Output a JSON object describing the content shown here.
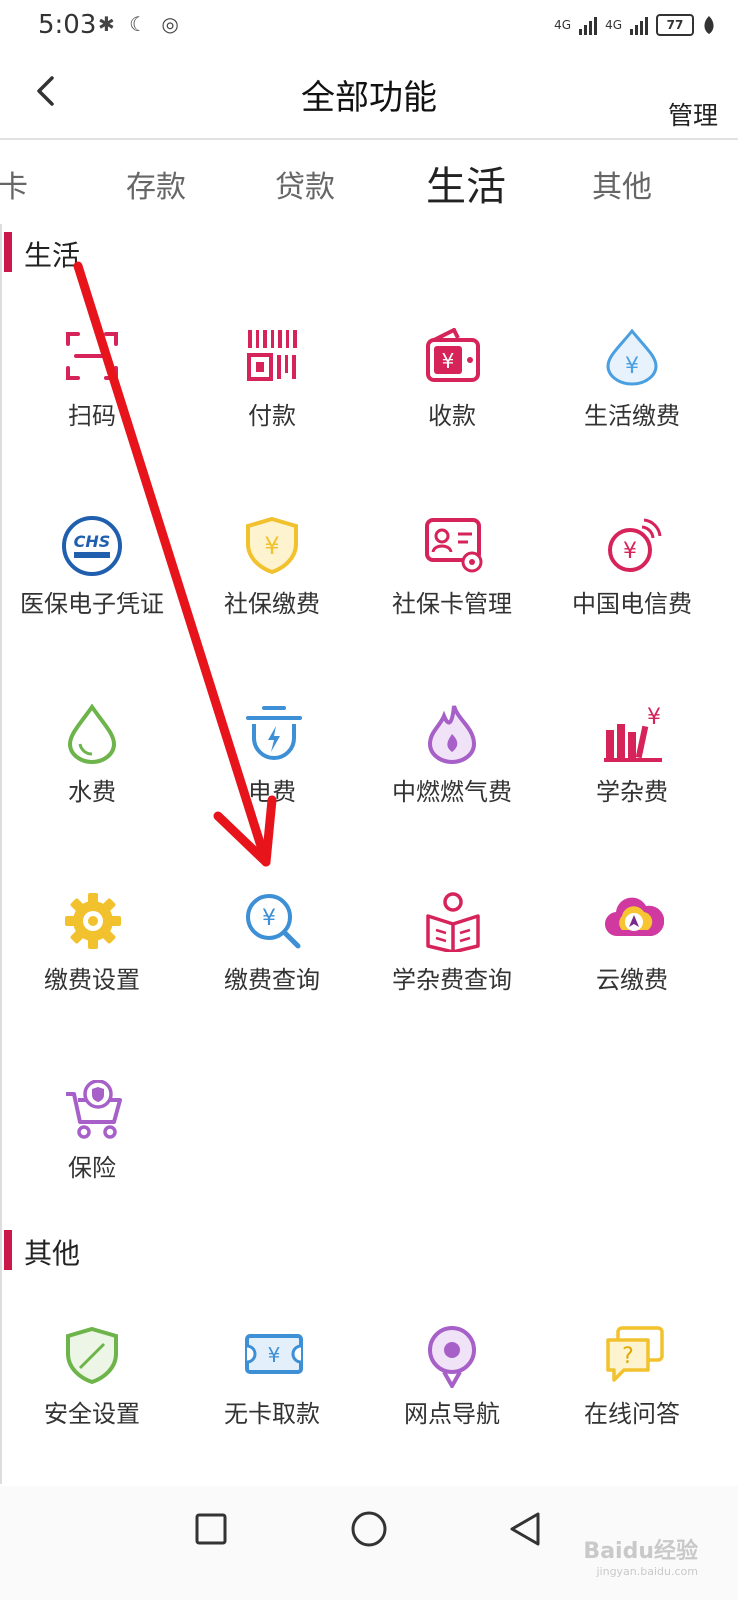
{
  "status_bar": {
    "time": "5:03",
    "icons": "✱ ☾ ◎",
    "signal1": "4G",
    "signal2": "4G",
    "battery": "77"
  },
  "header": {
    "title": "全部功能",
    "manage_label": "管理"
  },
  "tabs": [
    "卡",
    "存款",
    "贷款",
    "生活",
    "其他"
  ],
  "active_tab": "生活",
  "sections": [
    {
      "title": "生活",
      "items": [
        {
          "label": "扫码",
          "icon": "scan-icon",
          "color": "#d6245a"
        },
        {
          "label": "付款",
          "icon": "barcode-icon",
          "color": "#d6245a"
        },
        {
          "label": "收款",
          "icon": "wallet-icon",
          "color": "#d6245a"
        },
        {
          "label": "生活缴费",
          "icon": "water-drop-yen-icon",
          "color": "#4a9fe0"
        },
        {
          "label": "医保电子凭证",
          "icon": "chs-logo-icon",
          "color": "#1f5fae"
        },
        {
          "label": "社保缴费",
          "icon": "shield-yen-icon",
          "color": "#f2c12e"
        },
        {
          "label": "社保卡管理",
          "icon": "card-gear-icon",
          "color": "#d6245a"
        },
        {
          "label": "中国电信费",
          "icon": "signal-yen-icon",
          "color": "#d6245a"
        },
        {
          "label": "水费",
          "icon": "water-drop-icon",
          "color": "#6db44a"
        },
        {
          "label": "电费",
          "icon": "lightning-pot-icon",
          "color": "#3d8fd6"
        },
        {
          "label": "中燃燃气费",
          "icon": "flame-icon",
          "color": "#a660c8"
        },
        {
          "label": "学杂费",
          "icon": "books-yen-icon",
          "color": "#d6245a"
        },
        {
          "label": "缴费设置",
          "icon": "gear-icon",
          "color": "#f2c12e"
        },
        {
          "label": "缴费查询",
          "icon": "search-yen-icon",
          "color": "#3d8fd6"
        },
        {
          "label": "学杂费查询",
          "icon": "reading-icon",
          "color": "#d6245a"
        },
        {
          "label": "云缴费",
          "icon": "cloud-icon",
          "color": "#d03aa0"
        },
        {
          "label": "保险",
          "icon": "cart-shield-icon",
          "color": "#a660c8"
        }
      ]
    },
    {
      "title": "其他",
      "items": [
        {
          "label": "安全设置",
          "icon": "security-shield-icon",
          "color": "#6db44a"
        },
        {
          "label": "无卡取款",
          "icon": "cash-ticket-icon",
          "color": "#3d8fd6"
        },
        {
          "label": "网点导航",
          "icon": "location-pin-icon",
          "color": "#a660c8"
        },
        {
          "label": "在线问答",
          "icon": "chat-question-icon",
          "color": "#f2c12e"
        }
      ]
    }
  ],
  "watermark": {
    "text": "Baidu经验",
    "sub": "jingyan.baidu.com"
  },
  "arrow_color": "#e8141c"
}
